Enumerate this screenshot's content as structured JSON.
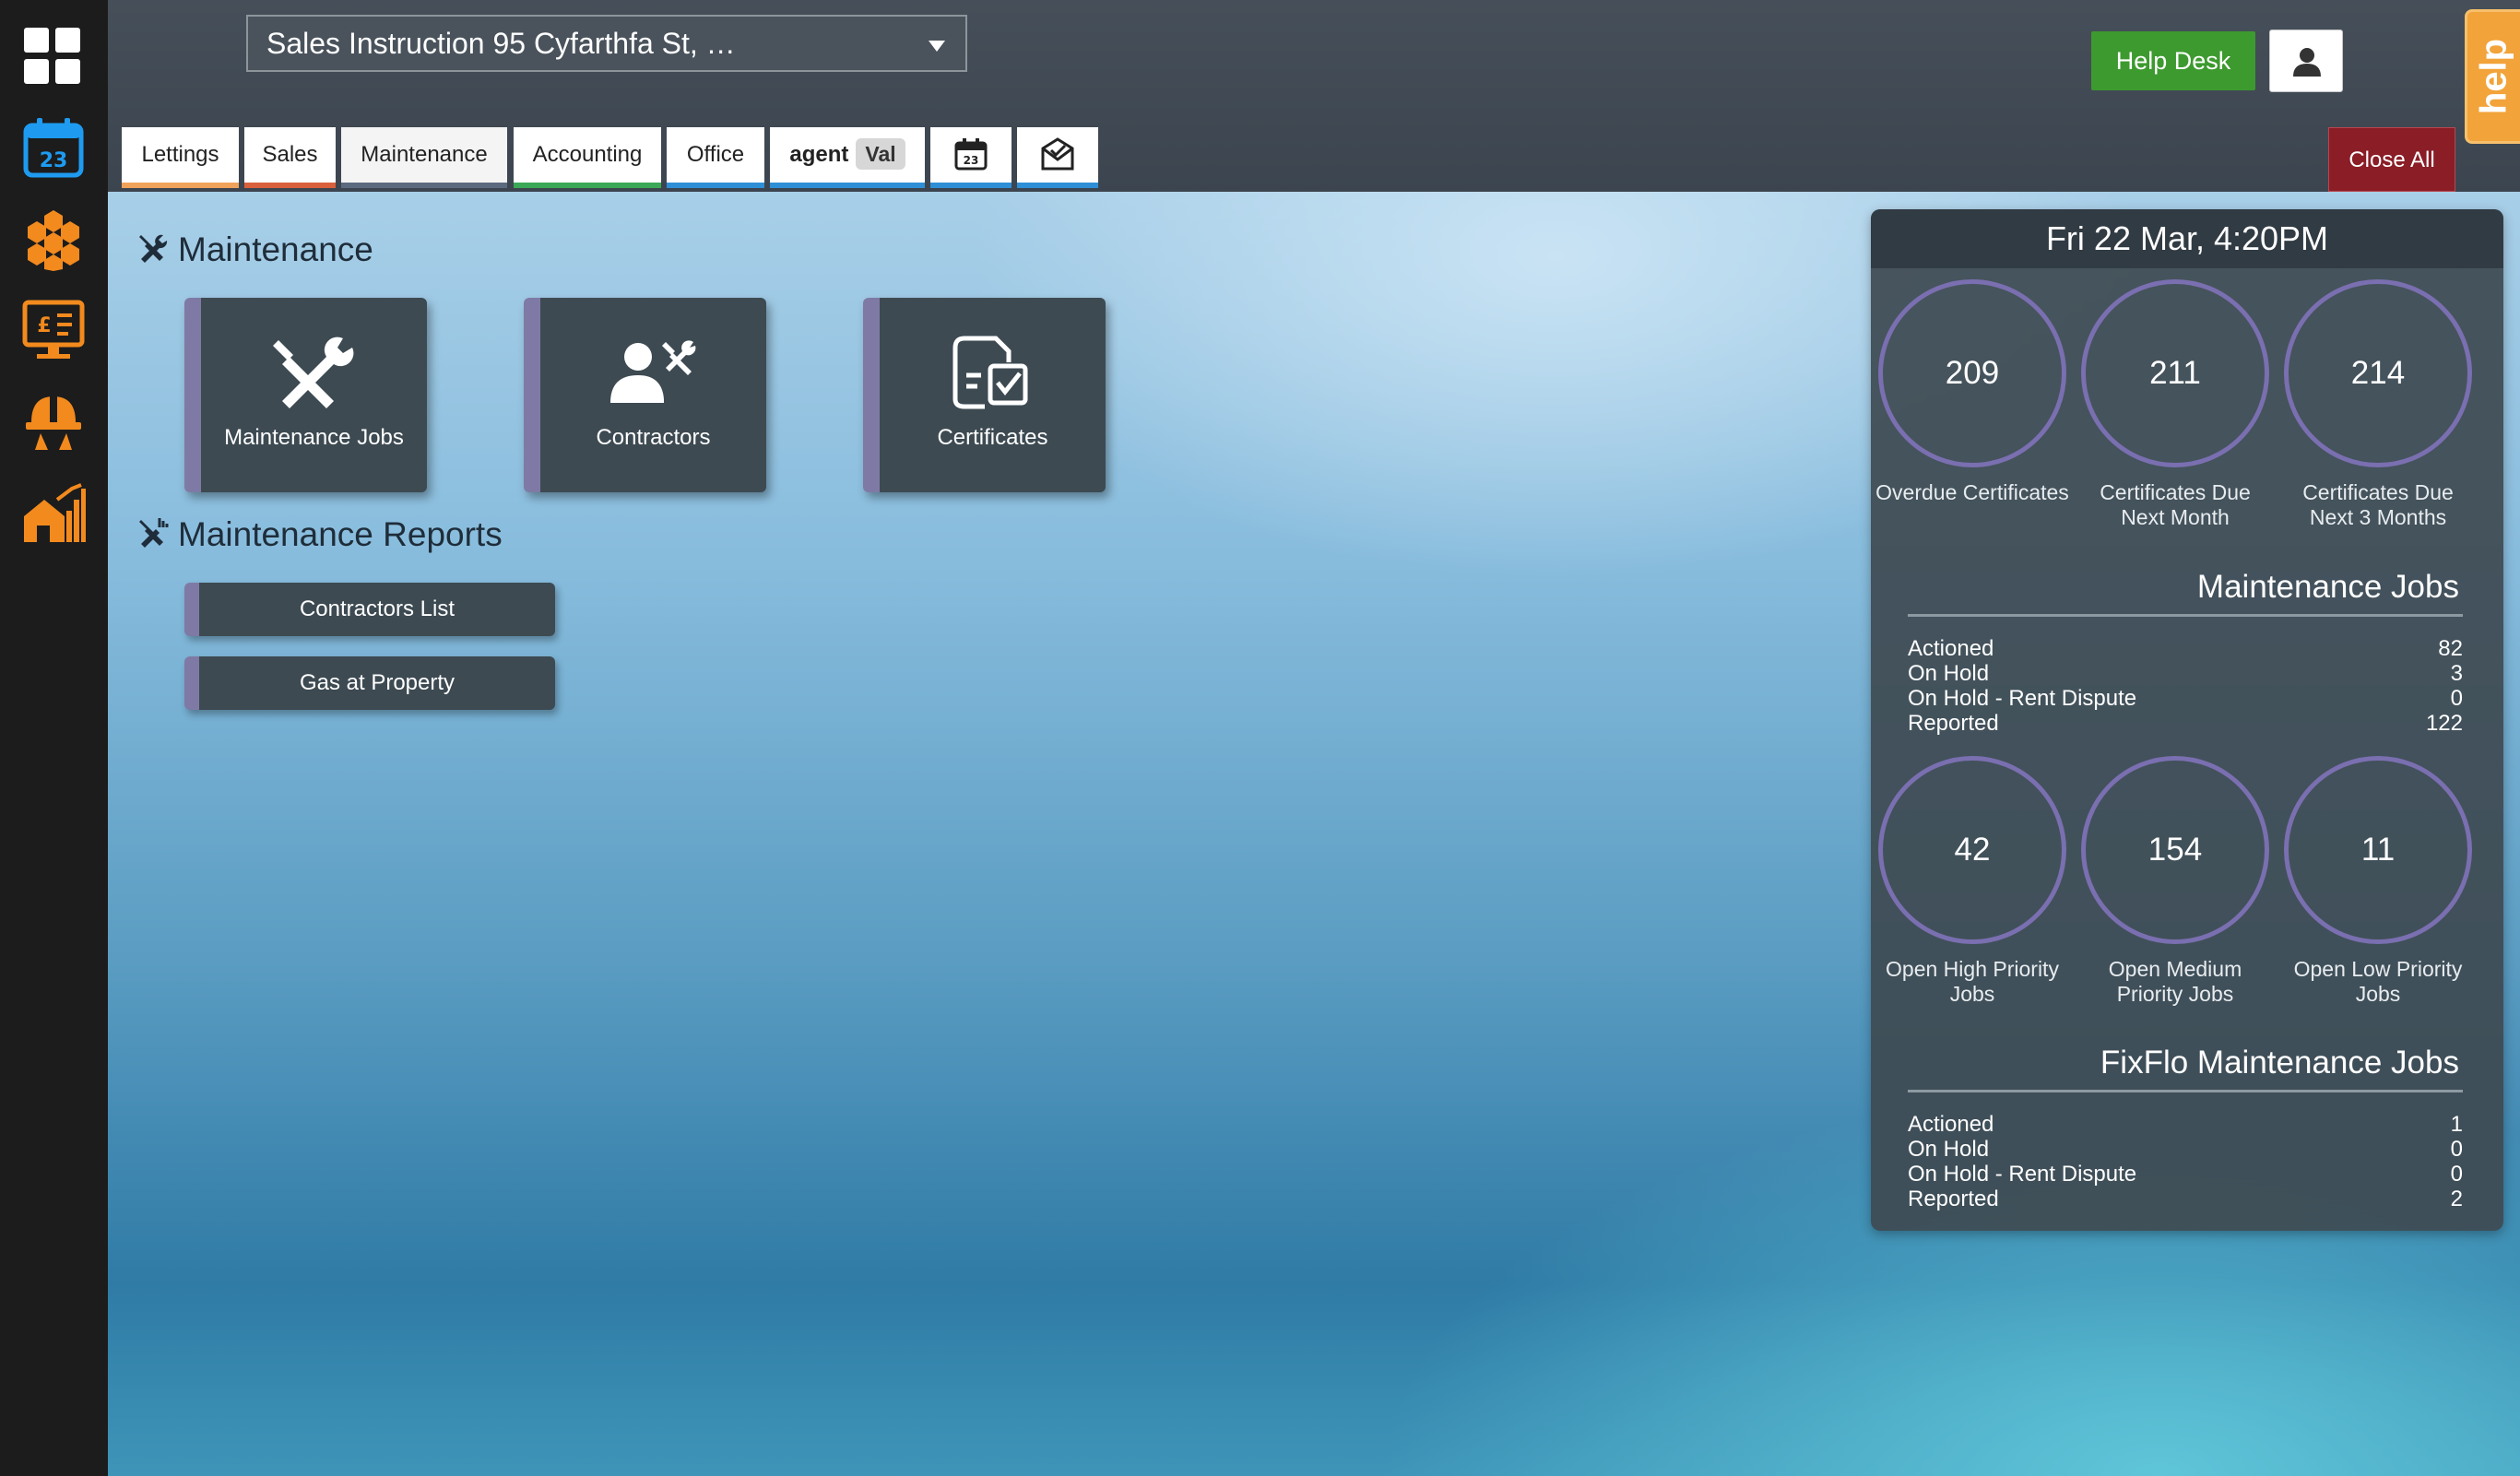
{
  "sidebar": {
    "icons": [
      {
        "name": "dashboard-grid-icon",
        "color": "#ffffff"
      },
      {
        "name": "calendar-icon",
        "color": "#1e9bf0",
        "day": "23"
      },
      {
        "name": "hexagon-cluster-icon",
        "color": "#f28a1e"
      },
      {
        "name": "finance-screen-icon",
        "color": "#f28a1e"
      },
      {
        "name": "contractor-helmet-icon",
        "color": "#f28a1e"
      },
      {
        "name": "property-chart-icon",
        "color": "#f28a1e"
      }
    ]
  },
  "header": {
    "search_value": "Sales Instruction 95 Cyfarthfa St, …",
    "help_desk_label": "Help Desk",
    "help_tab_label": "help",
    "close_all_label": "Close All"
  },
  "tabs": [
    {
      "label": "Lettings",
      "color": "#f0a25a"
    },
    {
      "label": "Sales",
      "color": "#d9603b"
    },
    {
      "label": "Maintenance",
      "color": "#5c6a80",
      "active": true
    },
    {
      "label": "Accounting",
      "color": "#3aa856"
    },
    {
      "label": "Office",
      "color": "#2f8fd6"
    },
    {
      "label": "agent",
      "badge": "Val",
      "color": "#2f8fd6"
    },
    {
      "icon": "calendar-tab-icon",
      "color": "#2f8fd6"
    },
    {
      "icon": "mail-check-icon",
      "color": "#2f8fd6"
    }
  ],
  "maintenance": {
    "title": "Maintenance",
    "tiles": [
      {
        "label": "Maintenance Jobs",
        "icon": "tools-icon"
      },
      {
        "label": "Contractors",
        "icon": "contractor-icon"
      },
      {
        "label": "Certificates",
        "icon": "certificate-icon"
      }
    ]
  },
  "reports": {
    "title": "Maintenance Reports",
    "buttons": [
      "Contractors List",
      "Gas at Property"
    ]
  },
  "panel": {
    "datetime": "Fri 22 Mar, 4:20PM",
    "certificates": [
      {
        "value": "209",
        "label": "Overdue Certificates"
      },
      {
        "value": "211",
        "label": "Certificates Due Next Month"
      },
      {
        "value": "214",
        "label": "Certificates Due Next 3 Months"
      }
    ],
    "maintenance_jobs": {
      "title": "Maintenance Jobs",
      "rows": [
        {
          "label": "Actioned",
          "value": "82"
        },
        {
          "label": "On Hold",
          "value": "3"
        },
        {
          "label": "On Hold - Rent Dispute",
          "value": "0"
        },
        {
          "label": "Reported",
          "value": "122"
        }
      ]
    },
    "priorities": [
      {
        "value": "42",
        "label": "Open High Priority Jobs"
      },
      {
        "value": "154",
        "label": "Open Medium Priority Jobs"
      },
      {
        "value": "11",
        "label": "Open Low Priority Jobs"
      }
    ],
    "fixflo_jobs": {
      "title": "FixFlo Maintenance Jobs",
      "rows": [
        {
          "label": "Actioned",
          "value": "1"
        },
        {
          "label": "On Hold",
          "value": "0"
        },
        {
          "label": "On Hold - Rent Dispute",
          "value": "0"
        },
        {
          "label": "Reported",
          "value": "2"
        }
      ]
    }
  }
}
